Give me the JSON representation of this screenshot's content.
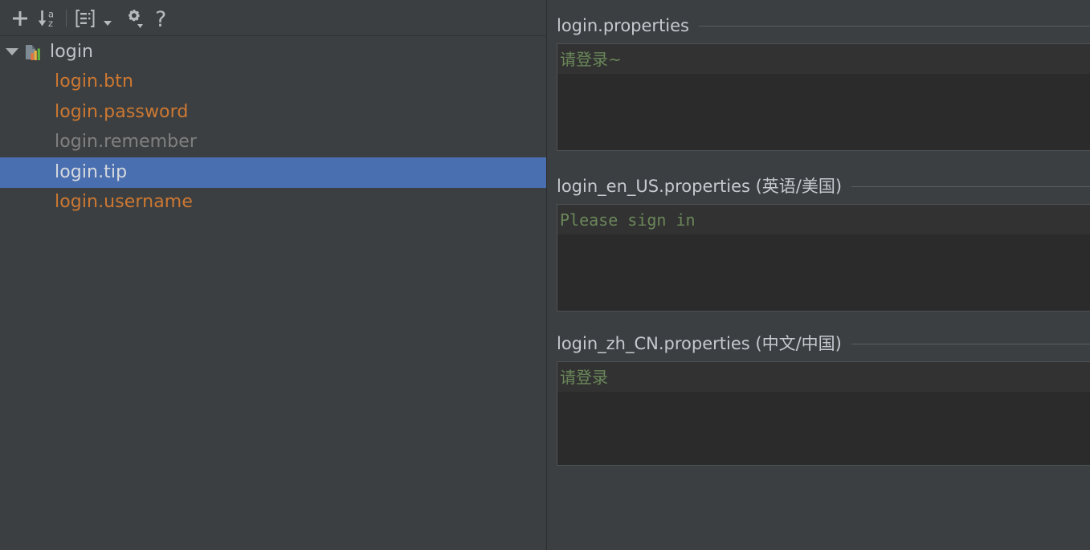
{
  "toolbar": {
    "buttons": [
      {
        "name": "add-button",
        "icon": "plus-icon",
        "tooltip": "Add Property"
      },
      {
        "name": "sort-alphabetically-button",
        "icon": "sort-alpha-down-icon",
        "tooltip": "Sort Alphabetically"
      },
      {
        "name": "group-by-button",
        "icon": "group-by-icon",
        "tooltip": "Group By"
      },
      {
        "name": "group-by-dropdown",
        "icon": "chevron-down-icon",
        "tooltip": "Show Options"
      },
      {
        "name": "settings-button",
        "icon": "gear-with-dropdown-icon",
        "tooltip": "Settings"
      },
      {
        "name": "help-button",
        "icon": "question-mark-icon",
        "tooltip": "Help"
      }
    ]
  },
  "tree": {
    "root": {
      "label": "login",
      "icon": "resource-bundle-icon",
      "expanded": true,
      "twisty": "triangle-down-icon"
    },
    "items": [
      {
        "label": "login.btn",
        "state": "translated",
        "selected": false
      },
      {
        "label": "login.password",
        "state": "translated",
        "selected": false
      },
      {
        "label": "login.remember",
        "state": "untranslated",
        "selected": false
      },
      {
        "label": "login.tip",
        "state": "selected",
        "selected": true
      },
      {
        "label": "login.username",
        "state": "translated",
        "selected": false
      }
    ]
  },
  "editors": [
    {
      "title": "login.properties",
      "value": "请登录~",
      "script": "cjk"
    },
    {
      "title": "login_en_US.properties (英语/美国)",
      "value": "Please sign in",
      "script": "latin"
    },
    {
      "title": "login_zh_CN.properties (中文/中国)",
      "value": "请登录",
      "script": "cjk"
    }
  ],
  "colors": {
    "panel_background": "#3c3f41",
    "editor_background": "#2b2b2b",
    "caret_line_background": "#323232",
    "selection_blue": "#4a6fb0",
    "key_orange": "#cc7832",
    "key_gray": "#808080",
    "string_green": "#6a8759",
    "text_light": "#c5cad0"
  }
}
